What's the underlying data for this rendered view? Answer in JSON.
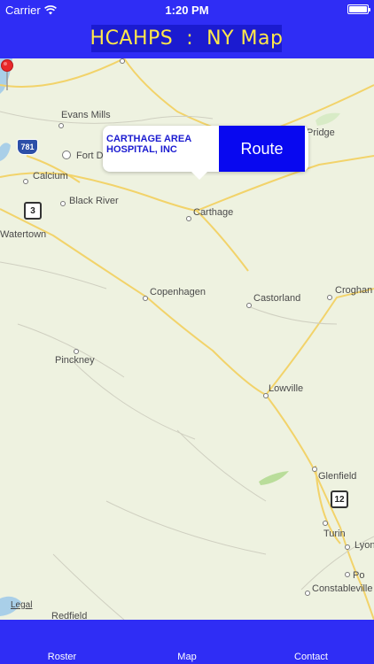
{
  "status_bar": {
    "carrier": "Carrier",
    "time": "1:20 PM",
    "wifi_icon": "wifi-icon",
    "battery_icon": "battery-icon"
  },
  "header": {
    "title": "HCAHPS  :  NY Map",
    "background_color": "#2f2df5",
    "title_color": "#ffe84a"
  },
  "map": {
    "places": {
      "evans_mills": "Evans Mills",
      "fort_drum": "Fort D",
      "calcium": "Calcium",
      "black_river": "Black River",
      "watertown": "Watertown",
      "carthage": "Carthage",
      "pridge": "Pridge",
      "copenhagen": "Copenhagen",
      "castorland": "Castorland",
      "croghan": "Croghan",
      "pinckney": "Pinckney",
      "lowville": "Lowville",
      "glenfield": "Glenfield",
      "turin": "Turin",
      "lyon": "Lyon",
      "po": "Po",
      "constableville": "Constableville",
      "redfield": "Redfield"
    },
    "route_shields": {
      "i781": "781",
      "ny3": "3",
      "ny12": "12"
    },
    "legal": "Legal",
    "callout": {
      "title": "CARTHAGE AREA HOSPITAL, INC",
      "route_label": "Route"
    }
  },
  "tabbar": {
    "tabs": [
      "Roster",
      "Map",
      "Contact"
    ]
  }
}
